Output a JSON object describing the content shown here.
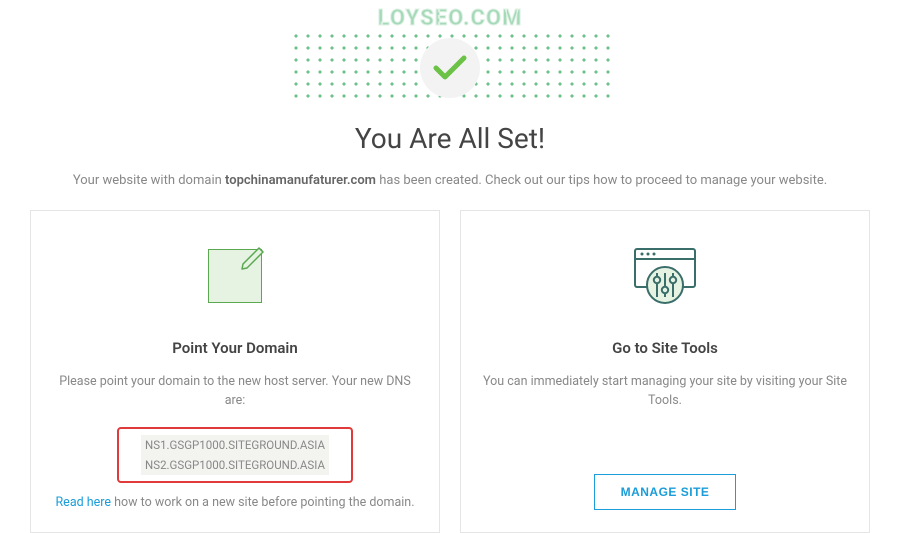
{
  "watermark": "LOYSEO.COM",
  "header": {
    "title": "You Are All Set!",
    "subtitle_prefix": "Your website with domain ",
    "subtitle_domain": "topchinamanufaturer.com",
    "subtitle_suffix": " has been created. Check out our tips how to proceed to manage your website."
  },
  "cards": {
    "left": {
      "title": "Point Your Domain",
      "text": "Please point your domain to the new host server. Your new DNS are:",
      "dns": [
        "NS1.GSGP1000.SITEGROUND.ASIA",
        "NS2.GSGP1000.SITEGROUND.ASIA"
      ],
      "read_here_label": "Read here",
      "read_here_suffix": " how to work on a new site before pointing the domain."
    },
    "right": {
      "title": "Go to Site Tools",
      "text": "You can immediately start managing your site by visiting your Site Tools.",
      "button": "MANAGE SITE"
    }
  },
  "colors": {
    "accent_green": "#6bc28a",
    "accent_blue": "#1a9dd9",
    "highlight_red": "#e03a3a"
  }
}
